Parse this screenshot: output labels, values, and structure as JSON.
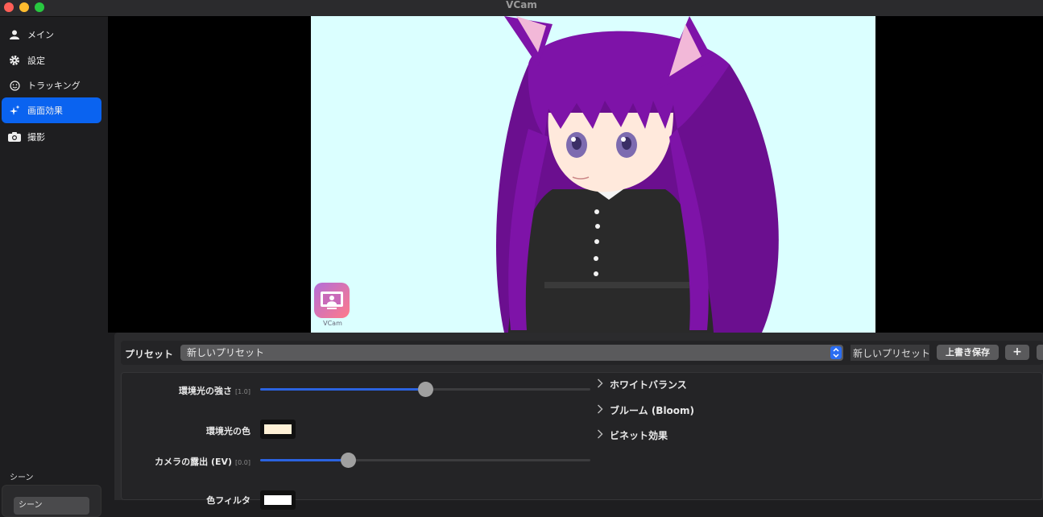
{
  "window": {
    "title": "VCam"
  },
  "sidebar": {
    "items": [
      {
        "label": "メイン",
        "icon": "person-icon",
        "active": false
      },
      {
        "label": "設定",
        "icon": "gear-icon",
        "active": false
      },
      {
        "label": "トラッキング",
        "icon": "face-icon",
        "active": false
      },
      {
        "label": "画面効果",
        "icon": "sparkles-icon",
        "active": true
      },
      {
        "label": "撮影",
        "icon": "camera-icon",
        "active": false
      }
    ],
    "scene_section_label": "シーン",
    "scenes": [
      "シーン"
    ]
  },
  "preview": {
    "background": "#dbffff",
    "watermark_label": "VCam"
  },
  "preset": {
    "label": "プリセット",
    "selected": "新しいプリセット",
    "name_field": "新しいプリセット",
    "save_label": "上書き保存",
    "add_label": "+"
  },
  "effects": {
    "ambient_intensity": {
      "label": "環境光の強さ",
      "value_text": "[1.0]",
      "fraction": 0.5
    },
    "ambient_color": {
      "label": "環境光の色",
      "color": "#fff1d6"
    },
    "exposure": {
      "label": "カメラの露出 (EV)",
      "value_text": "[0.0]",
      "fraction": 0.265
    },
    "color_filter": {
      "label": "色フィルタ",
      "color": "#ffffff"
    },
    "sections": [
      {
        "label": "ホワイトバランス"
      },
      {
        "label": "ブルーム (Bloom)"
      },
      {
        "label": "ビネット効果"
      }
    ]
  },
  "colors": {
    "accent": "#0a63f0",
    "slider_fill": "#2b63e0"
  }
}
